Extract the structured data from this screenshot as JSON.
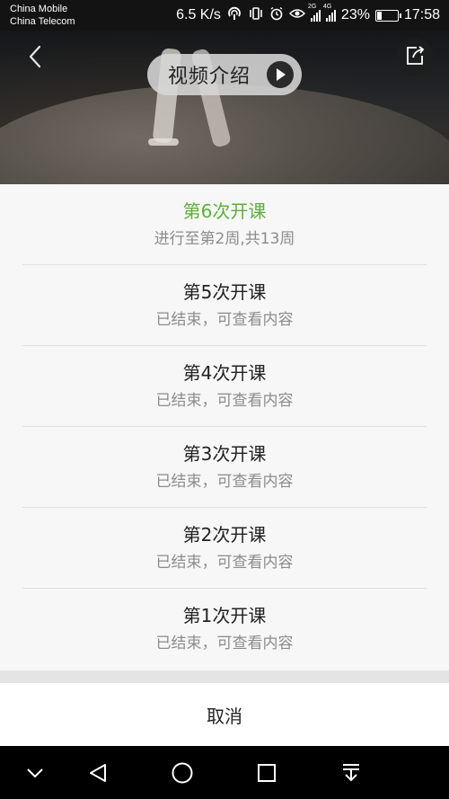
{
  "status_bar": {
    "carrier_1": "China Mobile",
    "carrier_2": "China Telecom",
    "speed": "6.5 K/s",
    "net_1": "2G",
    "net_2": "4G",
    "battery_text": "23%",
    "battery_level": 0.23,
    "time": "17:58"
  },
  "header": {
    "intro_label": "视频介绍",
    "back_icon": "chevron-left-icon",
    "share_icon": "share-icon",
    "play_icon": "play-icon"
  },
  "sessions": [
    {
      "title": "第6次开课",
      "status": "进行至第2周,共13周",
      "active": true
    },
    {
      "title": "第5次开课",
      "status": "已结束，可查看内容",
      "active": false
    },
    {
      "title": "第4次开课",
      "status": "已结束，可查看内容",
      "active": false
    },
    {
      "title": "第3次开课",
      "status": "已结束，可查看内容",
      "active": false
    },
    {
      "title": "第2次开课",
      "status": "已结束，可查看内容",
      "active": false
    },
    {
      "title": "第1次开课",
      "status": "已结束，可查看内容",
      "active": false
    }
  ],
  "cancel_label": "取消",
  "colors": {
    "accent": "#5cb03b",
    "sheet_bg": "#f7f7f7",
    "muted_text": "#8c8c8c"
  },
  "nav_bar": {
    "items": [
      "collapse-icon",
      "back-triangle-icon",
      "home-circle-icon",
      "recents-square-icon",
      "notification-pull-icon"
    ]
  }
}
